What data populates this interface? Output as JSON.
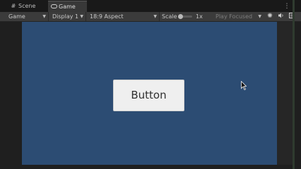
{
  "tabs": [
    {
      "label": "Scene",
      "icon": "grid-icon"
    },
    {
      "label": "Game",
      "icon": "gamepad-icon"
    }
  ],
  "toolbar": {
    "view_mode": "Game",
    "display": "Display 1",
    "aspect": "18:9 Aspect",
    "scale_label": "Scale",
    "scale_value": "1x",
    "scale_fraction": 0,
    "play_mode": "Play Focused"
  },
  "game_view": {
    "background_color": "#2c4c73",
    "button_label": "Button"
  }
}
